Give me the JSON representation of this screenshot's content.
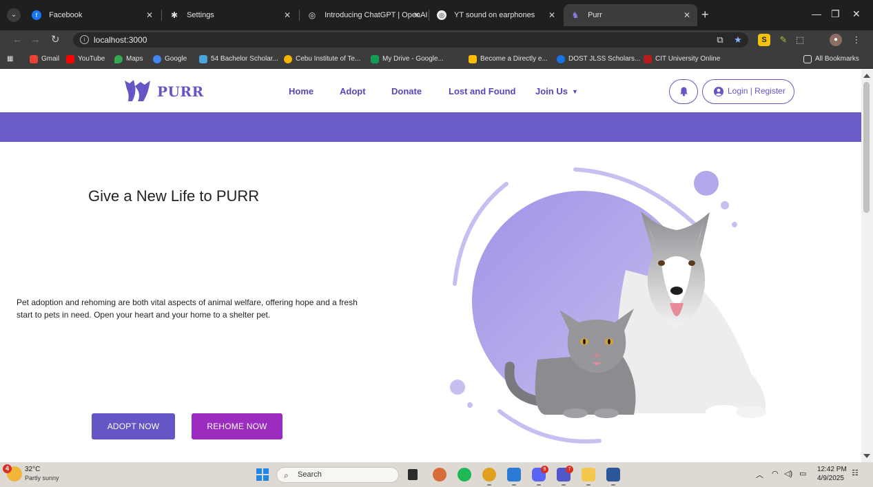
{
  "browser": {
    "tabs": [
      {
        "label": "Facebook",
        "favicon": "facebook-icon",
        "color": "#1877f2",
        "glyph": "f"
      },
      {
        "label": "Settings",
        "favicon": "gear-icon",
        "color": "#5f6368",
        "glyph": "✱"
      },
      {
        "label": "Introducing ChatGPT | OpenAI",
        "favicon": "openai-icon",
        "color": "#4a4a4a",
        "glyph": "◎"
      },
      {
        "label": "YT sound on earphones",
        "favicon": "chatgpt-icon",
        "color": "#4a4a4a",
        "glyph": "◎"
      },
      {
        "label": "Purr",
        "favicon": "purr-icon",
        "color": "#6457c5",
        "glyph": "♞"
      }
    ],
    "url": "localhost:3000",
    "bookmarks": [
      {
        "label": "Gmail",
        "color": "#ea4335"
      },
      {
        "label": "YouTube",
        "color": "#ff0000"
      },
      {
        "label": "Maps",
        "color": "#34a853"
      },
      {
        "label": "Google",
        "color": "#4285f4"
      },
      {
        "label": "54 Bachelor Scholar...",
        "color": "#4aa3df"
      },
      {
        "label": "Cebu Institute of Te...",
        "color": "#f4b400"
      },
      {
        "label": "My Drive - Google...",
        "color": "#0f9d58"
      },
      {
        "label": "Become a Directly e...",
        "color": "#fbbc05"
      },
      {
        "label": "DOST JLSS Scholars...",
        "color": "#1a73e8"
      },
      {
        "label": "CIT University Online",
        "color": "#b71c1c"
      }
    ],
    "all_bookmarks": "All Bookmarks"
  },
  "site": {
    "logo_text": "PURR",
    "brand_color": "#6457c5",
    "nav": {
      "home": "Home",
      "adopt": "Adopt",
      "donate": "Donate",
      "lost_found": "Lost and Found",
      "join_us": "Join Us"
    },
    "login_label": "Login | Register"
  },
  "hero": {
    "title": "Give a New Life to PURR",
    "description": "Pet adoption and rehoming are both vital aspects of animal welfare, offering hope and a fresh start to pets in need. Open your heart and your home to a shelter pet.",
    "adopt_button": "ADOPT NOW",
    "rehome_button": "REHOME NOW",
    "adopt_color": "#6457c5",
    "rehome_color": "#9c2cbf"
  },
  "taskbar": {
    "temperature": "32°C",
    "condition": "Partly sunny",
    "weather_badge": "4",
    "search_label": "Search",
    "time": "12:42 PM",
    "date": "4/9/2025"
  }
}
